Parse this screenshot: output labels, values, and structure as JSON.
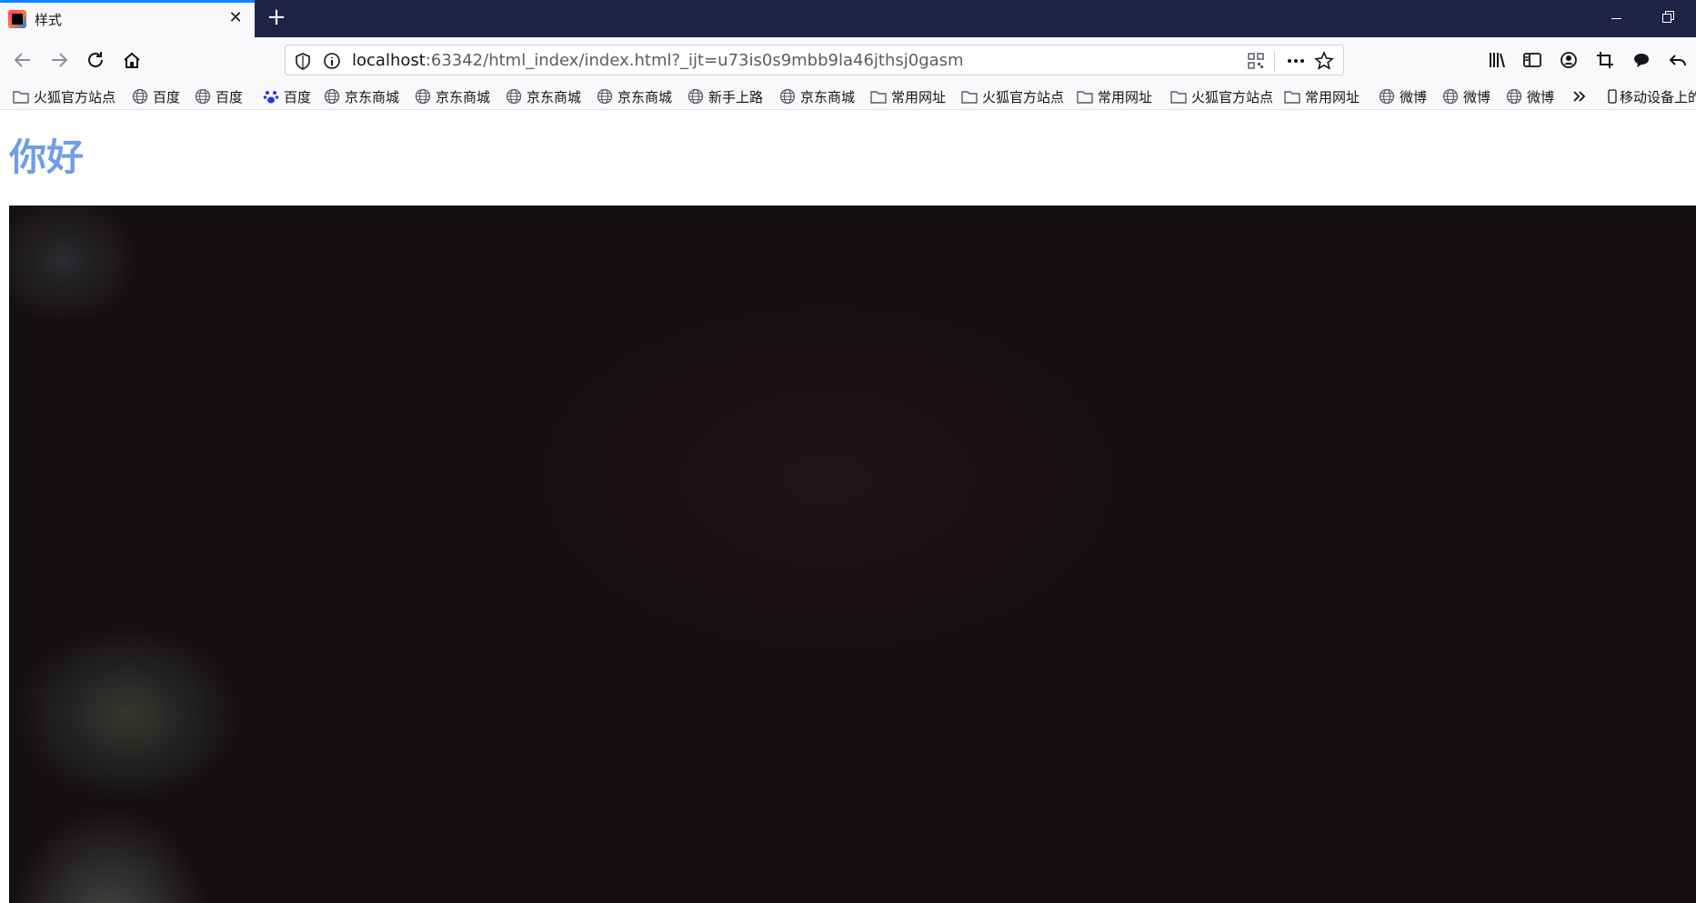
{
  "window": {
    "tab_title": "样式",
    "tab_close": "✕",
    "new_tab": "+"
  },
  "navbar": {
    "url_host": "localhost",
    "url_rest": ":63342/html_index/index.html?_ijt=u73is0s9mbb9la46jthsj0gasm"
  },
  "bookmarks": [
    {
      "label": "火狐官方站点",
      "icon": "folder-icon"
    },
    {
      "label": "百度",
      "icon": "globe-icon"
    },
    {
      "label": "百度",
      "icon": "globe-icon"
    },
    {
      "label": "百度",
      "icon": "paw-icon"
    },
    {
      "label": "京东商城",
      "icon": "globe-icon"
    },
    {
      "label": "京东商城",
      "icon": "globe-icon"
    },
    {
      "label": "京东商城",
      "icon": "globe-icon"
    },
    {
      "label": "京东商城",
      "icon": "globe-icon"
    },
    {
      "label": "新手上路",
      "icon": "globe-icon"
    },
    {
      "label": "京东商城",
      "icon": "globe-icon"
    },
    {
      "label": "常用网址",
      "icon": "folder-icon"
    },
    {
      "label": "火狐官方站点",
      "icon": "folder-icon"
    },
    {
      "label": "常用网址",
      "icon": "folder-icon"
    },
    {
      "label": "火狐官方站点",
      "icon": "folder-icon"
    },
    {
      "label": "常用网址",
      "icon": "folder-icon"
    },
    {
      "label": "微博",
      "icon": "globe-icon"
    },
    {
      "label": "微博",
      "icon": "globe-icon"
    },
    {
      "label": "微博",
      "icon": "globe-icon"
    }
  ],
  "mobile_bookmarks": "移动设备上的",
  "page": {
    "heading": "你好",
    "heading_color": "#6f9ee8"
  },
  "colors": {
    "titlebar": "#1f2346",
    "toolbar": "#f9f9fb",
    "accent": "#0a84ff"
  }
}
